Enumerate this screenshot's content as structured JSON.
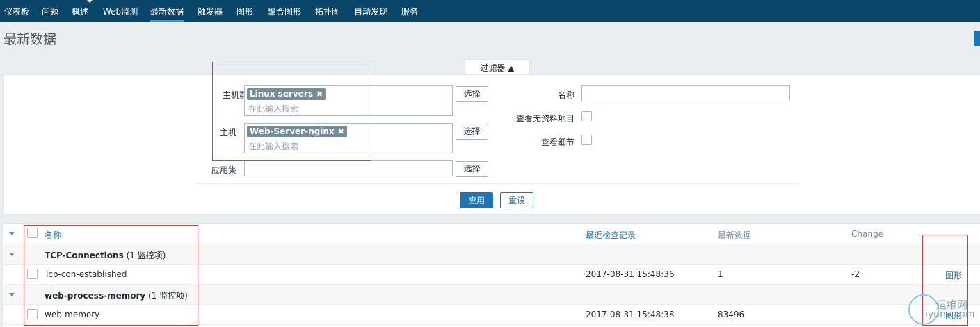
{
  "nav": {
    "items": [
      "仪表板",
      "问题",
      "概述",
      "Web监测",
      "最新数据",
      "触发器",
      "图形",
      "聚合图形",
      "拓扑图",
      "自动发现",
      "服务"
    ],
    "active": "最新数据"
  },
  "page": {
    "title": "最新数据"
  },
  "filter": {
    "tab_label": "过滤器 ▲",
    "host_group": {
      "label": "主机群组",
      "tag": "Linux servers",
      "placeholder": "在此输入搜索",
      "select_label": "选择"
    },
    "host": {
      "label": "主机",
      "tag": "Web-Server-nginx",
      "placeholder": "在此输入搜索",
      "select_label": "选择"
    },
    "application": {
      "label": "应用集",
      "value": "",
      "select_label": "选择"
    },
    "name": {
      "label": "名称",
      "value": ""
    },
    "show_items_without_data": {
      "label": "查看无资料项目",
      "checked": false
    },
    "show_details": {
      "label": "查看细节",
      "checked": false
    },
    "apply_label": "应用",
    "reset_label": "重设"
  },
  "table": {
    "headers": {
      "name": "名称",
      "last_check": "最近检查记录",
      "last_value": "最新数据",
      "change": "Change"
    },
    "groups": [
      {
        "name": "TCP-Connections",
        "count": "(1 监控项)",
        "items": [
          {
            "name": "Tcp-con-established",
            "last_check": "2017-08-31 15:48:36",
            "last_value": "1",
            "change": "-2",
            "action": "图形"
          }
        ]
      },
      {
        "name": "web-process-memory",
        "count": "(1 监控项)",
        "items": [
          {
            "name": "web-memory",
            "last_check": "2017-08-31 15:48:38",
            "last_value": "83496",
            "change": "",
            "action": "图形"
          }
        ]
      }
    ]
  },
  "watermark": {
    "line1": "运维网",
    "line2": "iyunv.com"
  },
  "colors": {
    "nav_bg": "#0a466a",
    "accent": "#1e74b3",
    "annotation_red": "#e33734"
  }
}
